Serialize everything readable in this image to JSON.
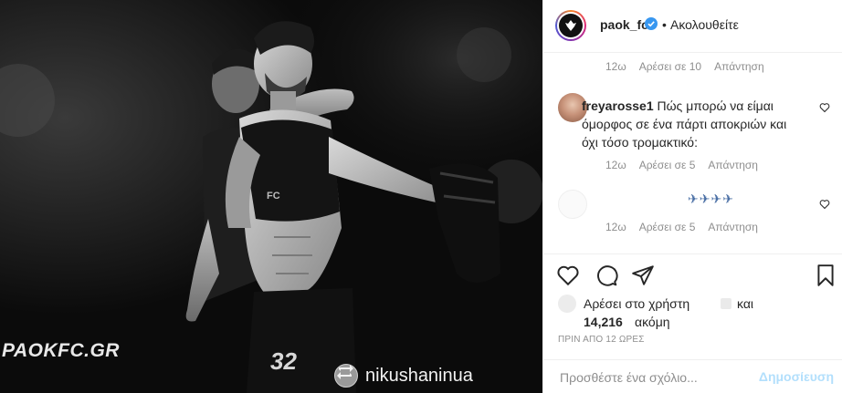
{
  "photo": {
    "watermark": "PAOKFC.GR",
    "jersey_number": "32",
    "shirt_text": "FC",
    "repost_username": "nikushaninua"
  },
  "header": {
    "username": "paok_fc",
    "verified": true,
    "separator": "•",
    "follow_status": "Ακολουθείτε"
  },
  "comments": [
    {
      "time": "12ω",
      "likes": "Αρέσει σε 10",
      "reply": "Απάντηση"
    },
    {
      "username": "freyarosse1",
      "text": "Πώς μπορώ να είμαι όμορφος σε ένα πάρτι αποκριών και όχι τόσο τρομακτικό:",
      "time": "12ω",
      "likes": "Αρέσει σε 5",
      "reply": "Απάντηση"
    },
    {
      "text": "✈✈✈✈",
      "time": "12ω",
      "likes": "Αρέσει σε 5",
      "reply": "Απάντηση"
    }
  ],
  "actions": {
    "liked_by_prefix": "Αρέσει στο χρήστη",
    "liked_by_and": "και",
    "likes_count": "14,216",
    "likes_more": "ακόμη",
    "timestamp": "ΠΡΙΝ ΑΠΟ 12 ΩΡΕΣ"
  },
  "add_comment": {
    "placeholder": "Προσθέστε ένα σχόλιο...",
    "post_label": "Δημοσίευση"
  },
  "colors": {
    "accent_blue": "#0095f6",
    "disabled_blue": "#b2dffc",
    "muted_text": "#8e8e8e"
  }
}
